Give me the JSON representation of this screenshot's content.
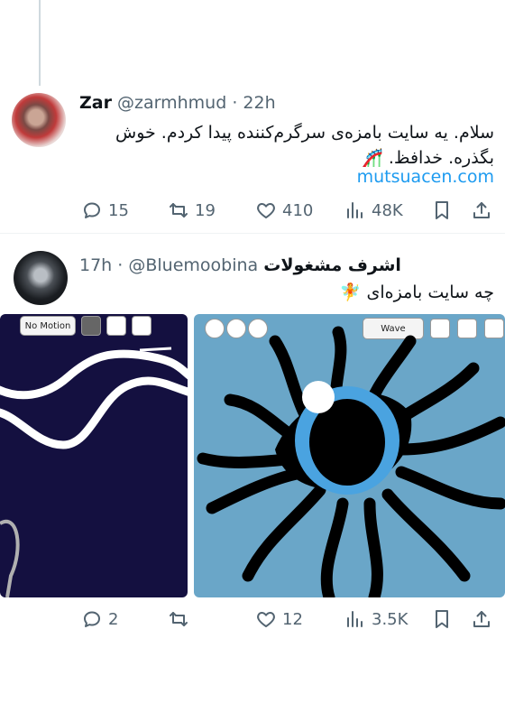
{
  "tweet1": {
    "name": "Zar",
    "handle": "@zarmhmud",
    "dot": "·",
    "time": "22h",
    "text": "سلام. یه سایت بامزه‌ی سرگرم‌کننده پیدا کردم. خوش بگذره. خدافظ. 🎢",
    "link": "mutsuacen.com",
    "replies": "15",
    "reposts": "19",
    "likes": "410",
    "views": "48K"
  },
  "tweet2": {
    "name": "اشرف مشغولات",
    "handle": "@Bluemoobina",
    "dot": "·",
    "time": "17h",
    "text": "چه سایت بامزه‌ای 🧚",
    "media_left": {
      "button_label": "No Motion"
    },
    "media_right": {
      "button_label": "Wave"
    },
    "replies": "2",
    "reposts": "",
    "likes": "12",
    "views": "3.5K"
  },
  "colors": {
    "link": "#1d9bf0",
    "secondary_text": "#536471",
    "canvas_dark": "#141040",
    "canvas_blue": "#6aa6c8"
  }
}
